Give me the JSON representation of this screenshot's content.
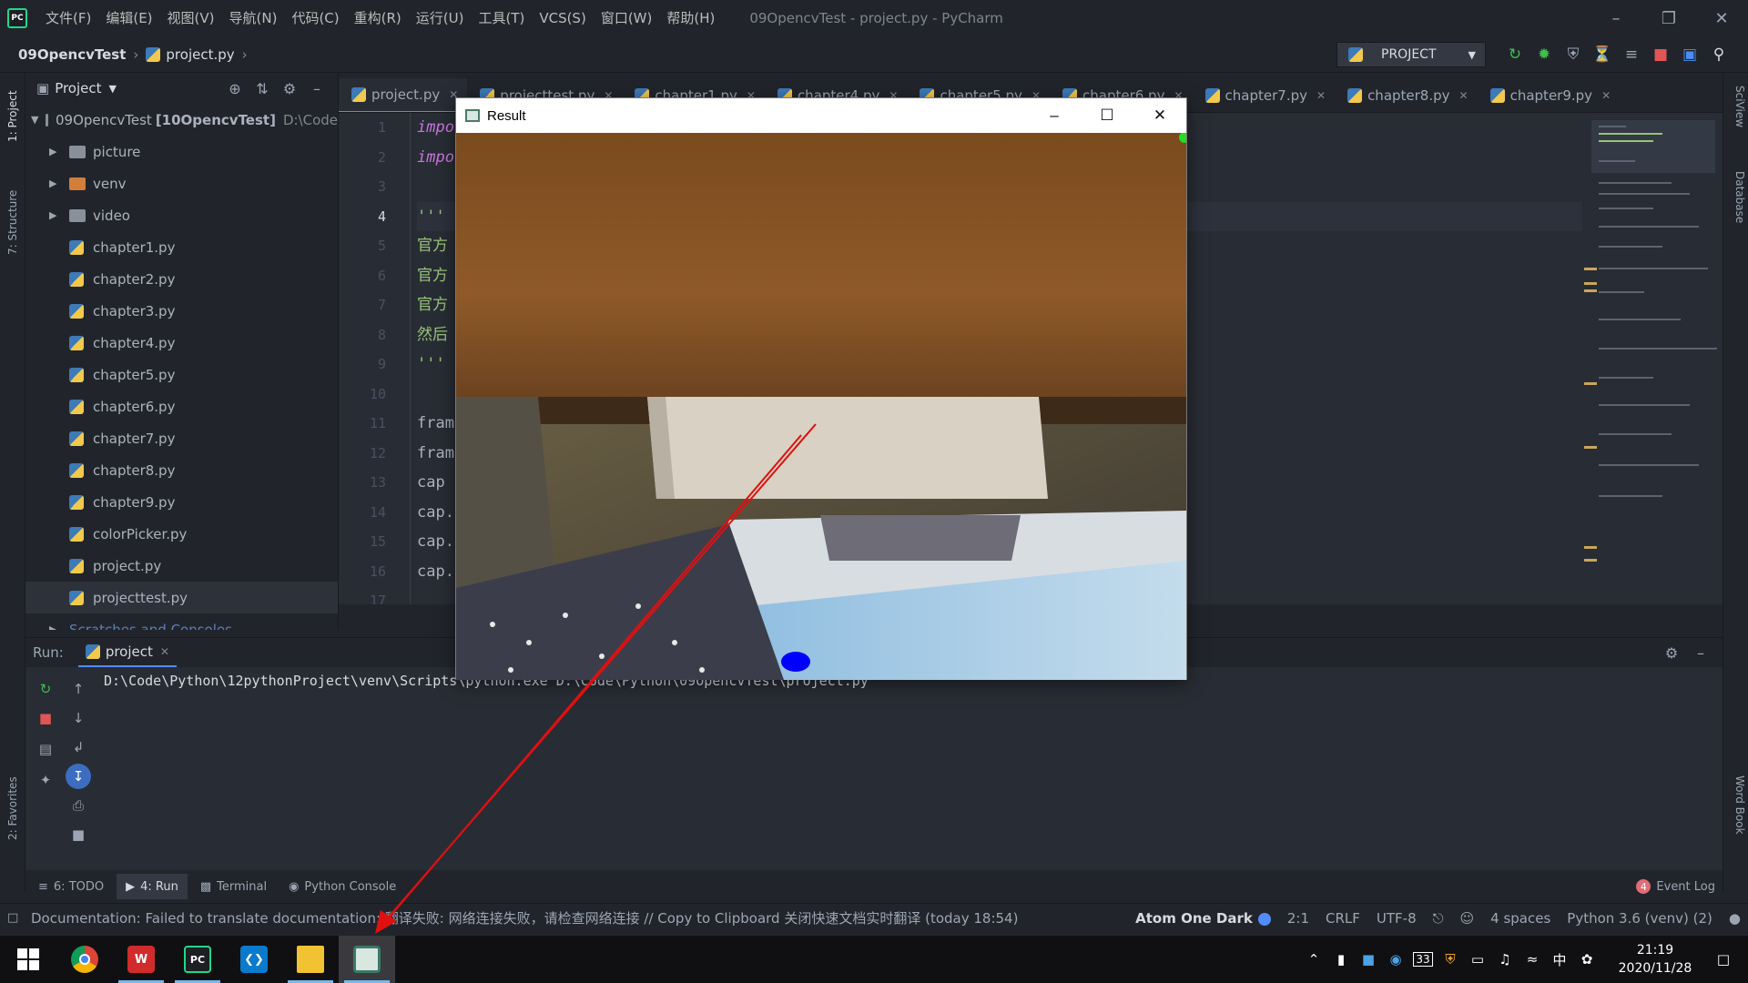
{
  "titlebar": {
    "logo_text": "PC",
    "menu": [
      "文件(F)",
      "编辑(E)",
      "视图(V)",
      "导航(N)",
      "代码(C)",
      "重构(R)",
      "运行(U)",
      "工具(T)",
      "VCS(S)",
      "窗口(W)",
      "帮助(H)"
    ],
    "window_title": "09OpencvTest - project.py - PyCharm"
  },
  "navbar": {
    "project": "09OpencvTest",
    "file": "project.py",
    "run_config": "PROJECT"
  },
  "left_stripe": {
    "project": "1: Project",
    "structure": "7: Structure",
    "favorites": "2: Favorites"
  },
  "right_stripe": {
    "sciview": "SciView",
    "database": "Database",
    "wordbook": "Word Book"
  },
  "project_panel": {
    "header": "Project",
    "root": "09OpencvTest",
    "root_module": "[10OpencvTest]",
    "root_path": "D:\\Code",
    "folders": [
      "picture",
      "venv",
      "video"
    ],
    "files": [
      "chapter1.py",
      "chapter2.py",
      "chapter3.py",
      "chapter4.py",
      "chapter5.py",
      "chapter6.py",
      "chapter7.py",
      "chapter8.py",
      "chapter9.py",
      "colorPicker.py",
      "project.py",
      "projecttest.py"
    ],
    "scratches": "Scratches and Consoles"
  },
  "editor_tabs": [
    "project.py",
    "projecttest.py",
    "chapter1.py",
    "chapter4.py",
    "chapter5.py",
    "chapter6.py",
    "chapter7.py",
    "chapter8.py",
    "chapter9.py"
  ],
  "editor": {
    "line_numbers": [
      "1",
      "2",
      "3",
      "4",
      "5",
      "6",
      "7",
      "8",
      "9",
      "10",
      "11",
      "12",
      "13",
      "14",
      "15",
      "16",
      "17"
    ],
    "lines": [
      "impo",
      "impo",
      "",
      "'''",
      "官方",
      "官方",
      "官方",
      "然后",
      "'''",
      "",
      "fram",
      "fram",
      "cap ",
      "cap.",
      "cap.",
      "cap.",
      ""
    ]
  },
  "run_panel": {
    "label": "Run:",
    "tab": "project",
    "console_line": "D:\\Code\\Python\\12pythonProject\\venv\\Scripts\\python.exe D:\\Code\\Python\\09OpencvTest\\project.py"
  },
  "bottom_tabs": {
    "todo": "6: TODO",
    "run": "4: Run",
    "terminal": "Terminal",
    "python_console": "Python Console",
    "event_log_count": "4",
    "event_log": "Event Log"
  },
  "statusbar": {
    "message": "Documentation: Failed to translate documentation: 翻译失败: 网络连接失败，请检查网络连接 // Copy to Clipboard   关闭快速文档实时翻译 (today 18:54)",
    "theme": "Atom One Dark",
    "position": "2:1",
    "line_sep": "CRLF",
    "encoding": "UTF-8",
    "indent": "4 spaces",
    "interpreter": "Python 3.6 (venv) (2)"
  },
  "result_window": {
    "title": "Result"
  },
  "taskbar": {
    "apps": [
      "start",
      "chrome",
      "wps",
      "pycharm",
      "vscode",
      "explorer",
      "opencv-result"
    ],
    "tray_badge": "33",
    "ime": "中",
    "time": "21:19",
    "date": "2020/11/28"
  },
  "colors": {
    "ide_bg": "#21252b",
    "editor_bg": "#282c34",
    "accent": "#528bff",
    "annotation_arrow": "#e01010"
  }
}
